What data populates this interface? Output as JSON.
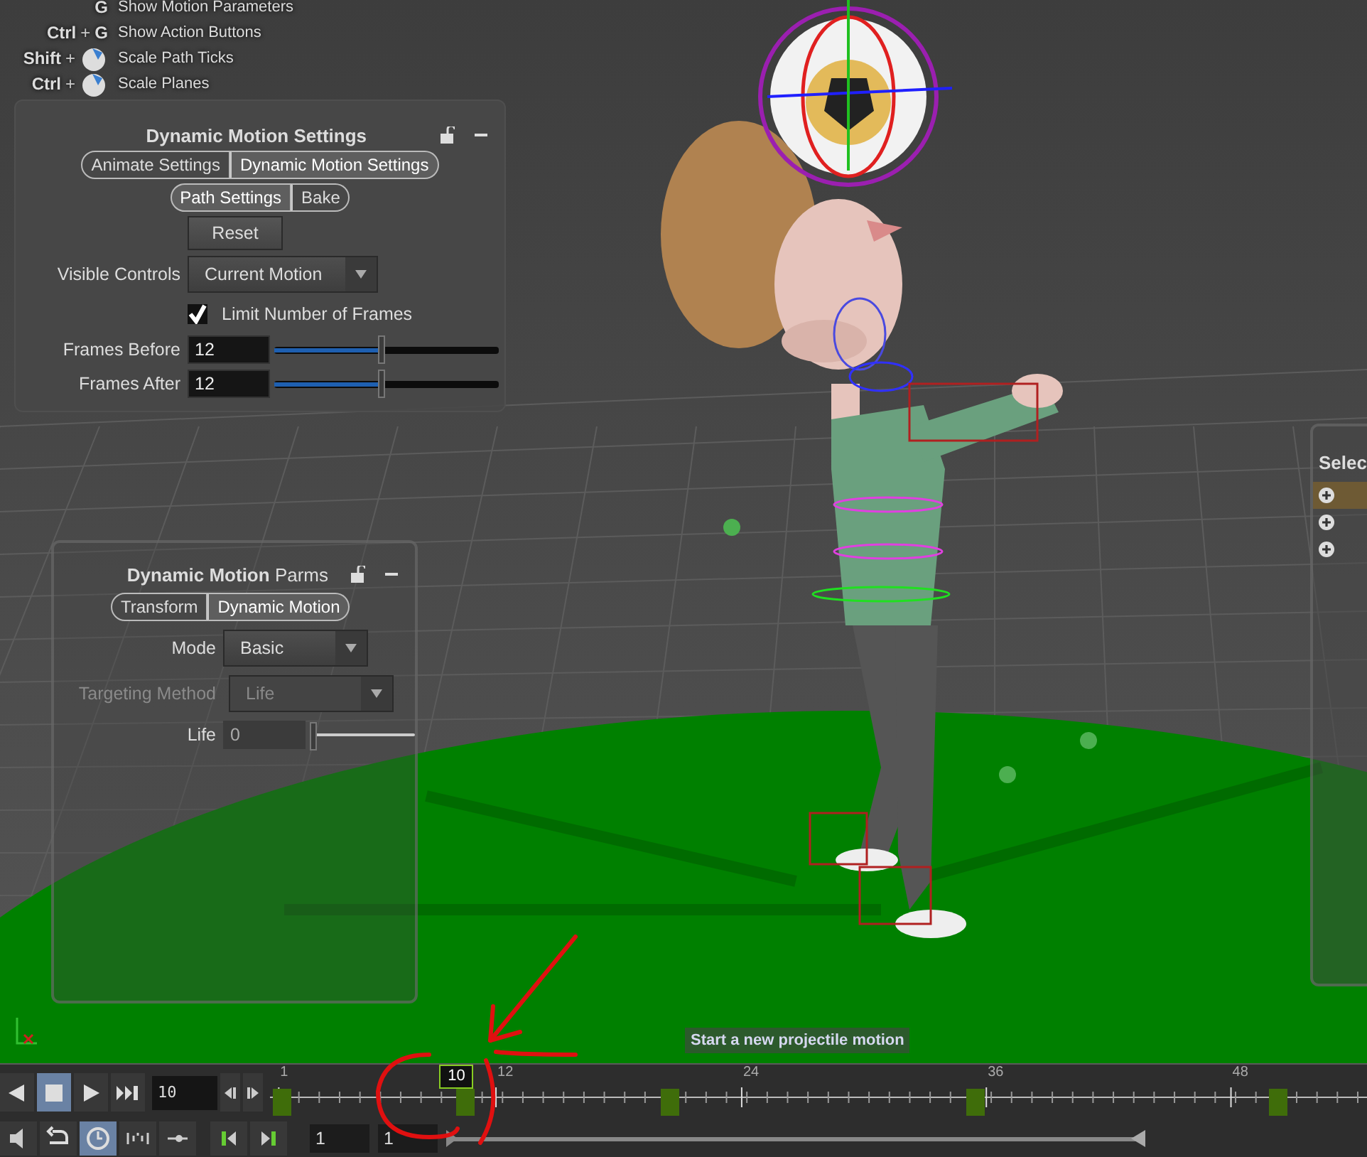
{
  "hotkeys": [
    {
      "keys": [
        {
          "kind": "key",
          "label": "G"
        }
      ],
      "action": "Show Motion Parameters"
    },
    {
      "keys": [
        {
          "kind": "key",
          "label": "Ctrl"
        },
        {
          "kind": "plus",
          "label": "+"
        },
        {
          "kind": "key",
          "label": "G"
        }
      ],
      "action": "Show Action Buttons"
    },
    {
      "keys": [
        {
          "kind": "key",
          "label": "Shift"
        },
        {
          "kind": "plus",
          "label": "+"
        },
        {
          "kind": "mouse"
        }
      ],
      "action": "Scale Path Ticks"
    },
    {
      "keys": [
        {
          "kind": "key",
          "label": "Ctrl"
        },
        {
          "kind": "plus",
          "label": "+"
        },
        {
          "kind": "mouse"
        }
      ],
      "action": "Scale Planes"
    }
  ],
  "settings_panel": {
    "title": "Dynamic Motion Settings",
    "tabs": [
      {
        "label": "Animate Settings",
        "selected": false
      },
      {
        "label": "Dynamic Motion Settings",
        "selected": true
      }
    ],
    "subtabs": [
      {
        "label": "Path Settings",
        "selected": true
      },
      {
        "label": "Bake",
        "selected": false
      }
    ],
    "reset_button": "Reset",
    "visible_controls": {
      "label": "Visible Controls",
      "value": "Current Motion"
    },
    "limit_frames": {
      "label": "Limit Number of Frames",
      "checked": true
    },
    "sliders": [
      {
        "label": "Frames Before",
        "value": "12",
        "level": 0.48
      },
      {
        "label": "Frames After",
        "value": "12",
        "level": 0.48
      }
    ]
  },
  "parms_panel": {
    "title": "**Dynamic Motion** Parms",
    "tabs": [
      {
        "label": "Transform",
        "selected": false
      },
      {
        "label": "Dynamic Motion",
        "selected": true
      }
    ],
    "fields": [
      {
        "kind": "dropdown",
        "label": "Mode",
        "value": "Basic",
        "disabled": false
      },
      {
        "kind": "dropdown",
        "label": "Targeting Method",
        "value": "Life",
        "disabled": true
      },
      {
        "kind": "slider",
        "label": "Life",
        "value": "0",
        "level": 0,
        "disabled": false
      }
    ]
  },
  "select_panel": {
    "title": "Selec",
    "rows": [
      {
        "selected": true
      },
      {
        "selected": false
      },
      {
        "selected": false
      }
    ]
  },
  "tooltip": "Start a new projectile motion",
  "playbar": {
    "transport": [
      {
        "kind": "prev",
        "selected": false
      },
      {
        "kind": "stop",
        "selected": true
      },
      {
        "kind": "play",
        "selected": false
      },
      {
        "kind": "end",
        "selected": false
      }
    ],
    "frame": "10",
    "ticks": [
      {
        "label": "1",
        "level": 0.008
      },
      {
        "label": "12",
        "level": 0.206
      },
      {
        "label": "24",
        "level": 0.43
      },
      {
        "label": "36",
        "level": 0.653
      },
      {
        "label": "48",
        "level": 0.876
      }
    ],
    "keyframes": [
      {
        "level": 0.01
      },
      {
        "level": 0.177
      },
      {
        "level": 0.364
      },
      {
        "level": 0.642
      },
      {
        "level": 0.919
      }
    ],
    "current": {
      "label": "10",
      "level": 0.17
    },
    "tools": [
      {
        "kind": "audio",
        "selected": false
      },
      {
        "kind": "undo",
        "selected": false
      },
      {
        "kind": "clock",
        "selected": true
      },
      {
        "kind": "range",
        "selected": false
      },
      {
        "kind": "slider",
        "selected": false
      },
      {
        "kind": "prev-key",
        "selected": false
      },
      {
        "kind": "next-key",
        "selected": false
      }
    ],
    "start": "1",
    "end": "1",
    "range": {
      "level": 0.76
    }
  }
}
